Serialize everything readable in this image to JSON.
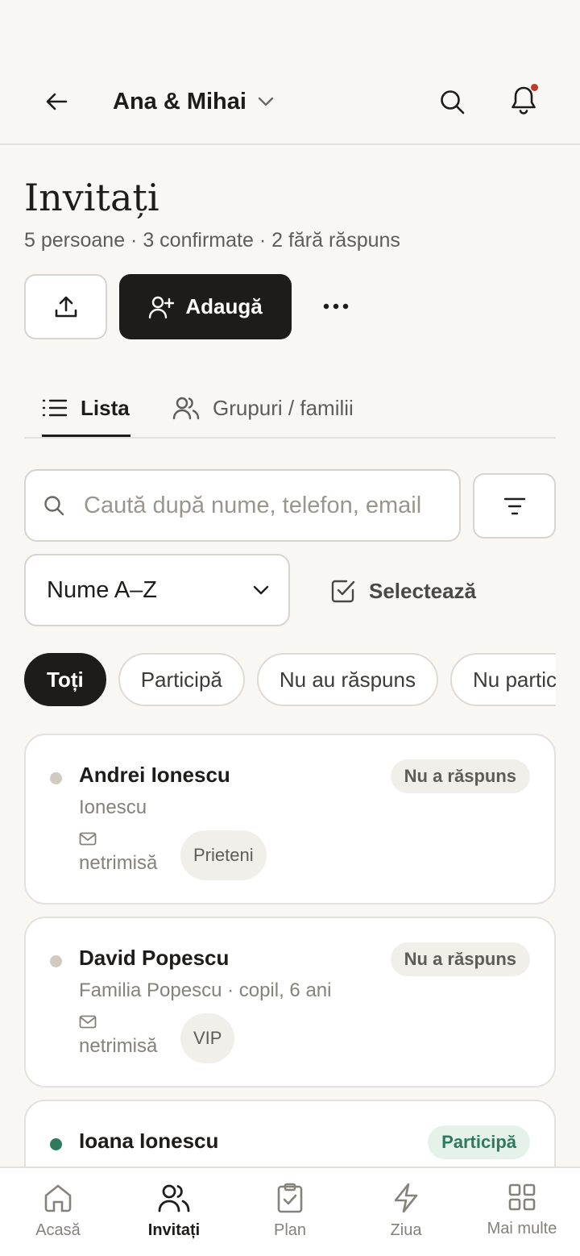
{
  "header": {
    "event_name": "Ana & Mihai"
  },
  "page": {
    "title": "Invitați",
    "subtitle": "5 persoane · 3 confirmate · 2 fără răspuns"
  },
  "actions": {
    "add_label": "Adaugă"
  },
  "tabs": [
    {
      "label": "Lista",
      "active": true
    },
    {
      "label": "Grupuri / familii",
      "active": false
    }
  ],
  "search": {
    "placeholder": "Caută după nume, telefon, email",
    "value": ""
  },
  "sort": {
    "selected": "Nume A–Z"
  },
  "select_label": "Selectează",
  "filters": [
    {
      "label": "Toți",
      "active": true
    },
    {
      "label": "Participă",
      "active": false
    },
    {
      "label": "Nu au răspuns",
      "active": false
    },
    {
      "label": "Nu participă",
      "active": false
    }
  ],
  "guests": [
    {
      "name": "Andrei Ionescu",
      "subtitle": "Ionescu",
      "invite_status": "netrimisă",
      "tag": "Prieteni",
      "rsvp": "Nu a răspuns"
    },
    {
      "name": "David Popescu",
      "subtitle": "Familia Popescu · copil, 6 ani",
      "invite_status": "netrimisă",
      "tag": "VIP",
      "rsvp": "Nu a răspuns"
    },
    {
      "name": "Ioana Ionescu",
      "subtitle": "",
      "invite_status": "",
      "tag": "",
      "rsvp": "Participă"
    }
  ],
  "nav": [
    {
      "label": "Acasă",
      "icon": "home-icon",
      "active": false
    },
    {
      "label": "Invitați",
      "icon": "users-icon",
      "active": true
    },
    {
      "label": "Plan",
      "icon": "clipboard-check-icon",
      "active": false
    },
    {
      "label": "Ziua",
      "icon": "lightning-icon",
      "active": false
    },
    {
      "label": "Mai multe",
      "icon": "grid-icon",
      "active": false
    }
  ],
  "colors": {
    "background": "#f8f7f4",
    "primary": "#1d1c1a",
    "pending_dot": "#cfcbc3",
    "attending_dot": "#2f7a5a",
    "pending_badge_bg": "#f1efea",
    "attending_badge_bg": "#e4f2ea",
    "attending_badge_text": "#2f7a5a",
    "notification_dot": "#c0392b"
  }
}
